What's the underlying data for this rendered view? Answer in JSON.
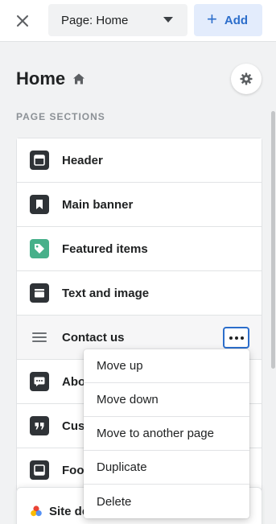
{
  "topbar": {
    "page_select_label": "Page: Home",
    "add_label": "Add"
  },
  "header": {
    "title": "Home",
    "section_heading": "PAGE SECTIONS"
  },
  "sections": [
    {
      "label": "Header",
      "icon": "header-section-icon"
    },
    {
      "label": "Main banner",
      "icon": "bookmark-icon"
    },
    {
      "label": "Featured items",
      "icon": "tag-icon"
    },
    {
      "label": "Text and image",
      "icon": "text-image-icon"
    },
    {
      "label": "Contact us",
      "icon": "drag-handle-icon"
    },
    {
      "label": "About",
      "icon": "chat-bubble-icon"
    },
    {
      "label": "Customer testimonials",
      "icon": "quote-icon"
    },
    {
      "label": "Footer",
      "icon": "footer-section-icon"
    }
  ],
  "site_details": {
    "label": "Site details"
  },
  "menu": {
    "items": [
      "Move up",
      "Move down",
      "Move to another page",
      "Duplicate",
      "Delete"
    ]
  },
  "colors": {
    "accent": "#2c6ecb",
    "icon_dark": "#2f3337",
    "icon_green": "#47b08a"
  }
}
